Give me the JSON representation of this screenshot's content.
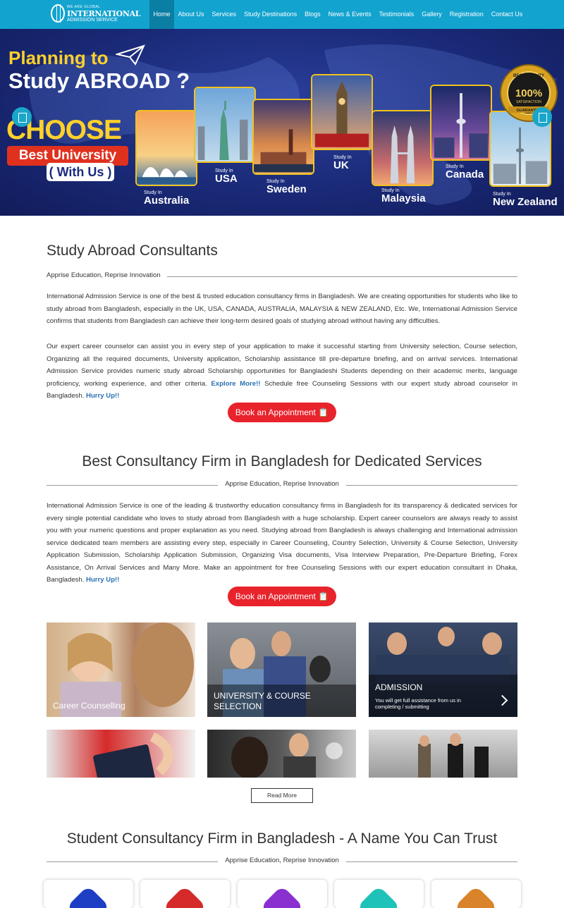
{
  "nav": {
    "logo": {
      "tagline": "WE ARE GLOBAL",
      "name": "INTERNATIONAL",
      "sub": "ADMISSION SERVICE"
    },
    "items": [
      "Home",
      "About Us",
      "Services",
      "Study Destinations",
      "Blogs",
      "News & Events",
      "Testimonials",
      "Gallery",
      "Registration",
      "Contact Us"
    ],
    "active": "Home"
  },
  "hero": {
    "line1": "Planning to",
    "line2": "Study ABROAD ?",
    "choose": "CHOOSE",
    "best": "Best University",
    "with_us": "( With Us )",
    "study_in": "Study In",
    "countries": [
      "Australia",
      "USA",
      "Sweden",
      "UK",
      "Malaysia",
      "Canada",
      "New Zealand"
    ],
    "badge": {
      "top": "BEST QUALITY",
      "percent": "100%",
      "sat": "SATISFACTION",
      "ribbon": "GUARANTEE"
    }
  },
  "s1": {
    "title": "Study Abroad Consultants",
    "tagline": "Apprise Education, Reprise Innovation",
    "p1": "International Admission Service is one of the best & trusted education consultancy firms in Bangladesh. We are creating opportunities for students who like to study abroad from Bangladesh, especially in the UK, USA, CANADA, AUSTRALIA, MALAYSIA & NEW ZEALAND, Etc. We, International Admission Service confirms that students from Bangladesh can achieve their long-term desired goals of studying abroad without having any difficulties.",
    "p2": "Our expert career counselor can assist you in every step of your application to make it successful starting from University selection, Course selection, Organizing all the required documents, University application, Scholarship assistance till pre-departure briefing, and on arrival services. International Admission Service provides numeric study abroad Scholarship opportunities for Bangladeshi Students depending on their academic merits, language proficiency, working experience, and other criteria.",
    "p2_link1": "Explore More!!",
    "p2_mid": "Schedule free Counseling Sessions with our expert study abroad counselor in Bangladesh.",
    "p2_link2": "Hurry Up!!",
    "button": "Book an Appointment 📋"
  },
  "s2": {
    "title": "Best Consultancy Firm in Bangladesh for Dedicated Services",
    "tagline": "Apprise Education, Reprise Innovation",
    "p": "International Admission Service is one of the leading & trustworthy education consultancy firms in Bangladesh for its transparency & dedicated services for every single potential candidate who loves to study abroad from Bangladesh with a huge scholarship. Expert career counselors are always ready to assist you with your numeric questions and proper explanation as you need. Studying abroad from Bangladesh is always challenging and International admission service dedicated team members are assisting every step, especially in Career Counseling, Country Selection, University & Course Selection, University Application Submission, Scholarship Application Submission, Organizing Visa documents, Visa Interview Preparation, Pre-Departure Briefing, Forex Assistance, On Arrival Services and Many More. Make an appointment for free Counseling Sessions with our expert education consultant in Dhaka, Bangladesh.",
    "p_link": "Hurry Up!!",
    "button": "Book an Appointment 📋",
    "tiles": [
      {
        "title": "Career Counselling"
      },
      {
        "title": "UNIVERSITY & COURSE SELECTION"
      },
      {
        "title": "ADMISSION",
        "sub": "You will get full assistance from us in completing / submitting"
      }
    ],
    "read_more": "Read More"
  },
  "s3": {
    "title": "Student Consultancy Firm in Bangladesh - A Name You Can Trust",
    "tagline": "Apprise Education, Reprise Innovation",
    "card_colors": [
      "#1e3fc4",
      "#d42a2a",
      "#8a2fd0",
      "#1fc2b8",
      "#d9832a"
    ]
  }
}
